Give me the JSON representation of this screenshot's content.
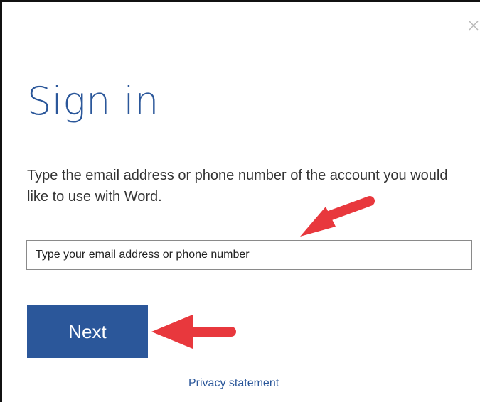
{
  "dialog": {
    "close_icon": "close-icon",
    "title": "Sign in",
    "instructions": "Type the email address or phone number of the account you would like to use with Word.",
    "email_placeholder": "Type your email address or phone number",
    "email_value": "",
    "next_label": "Next",
    "privacy_label": "Privacy statement"
  },
  "annotations": {
    "arrow_icon": "red-arrow-icon",
    "arrow_color": "#e8383d"
  },
  "colors": {
    "accent": "#2b579a",
    "text": "#333333",
    "border": "#8a8a8a"
  }
}
